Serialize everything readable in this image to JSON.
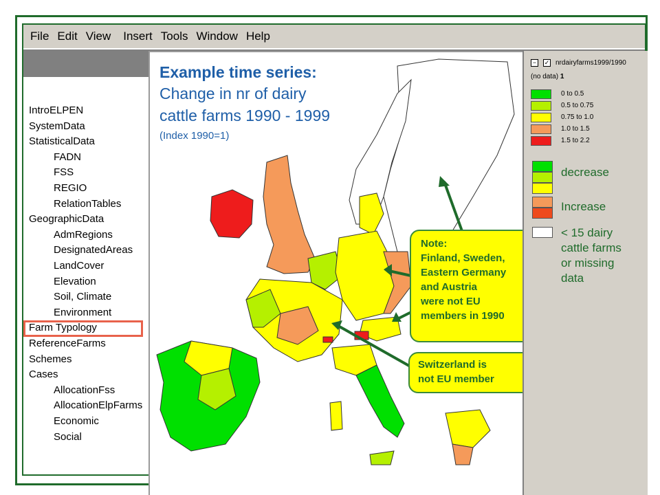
{
  "menu": [
    "File",
    "Edit",
    "View",
    "Insert",
    "Tools",
    "Window",
    "Help"
  ],
  "sidebar": {
    "items": [
      {
        "label": "IntroELPEN",
        "indent": 0
      },
      {
        "label": "SystemData",
        "indent": 0
      },
      {
        "label": "StatisticalData",
        "indent": 0
      },
      {
        "label": "FADN",
        "indent": 1
      },
      {
        "label": "FSS",
        "indent": 1
      },
      {
        "label": "REGIO",
        "indent": 1
      },
      {
        "label": "RelationTables",
        "indent": 1
      },
      {
        "label": "GeographicData",
        "indent": 0
      },
      {
        "label": "AdmRegions",
        "indent": 1
      },
      {
        "label": "DesignatedAreas",
        "indent": 1
      },
      {
        "label": "LandCover",
        "indent": 1
      },
      {
        "label": "Elevation",
        "indent": 1
      },
      {
        "label": "Soil, Climate",
        "indent": 1
      },
      {
        "label": "Environment",
        "indent": 1
      },
      {
        "label": "Farm Typology",
        "indent": 0,
        "selected": true
      },
      {
        "label": "ReferenceFarms",
        "indent": 0
      },
      {
        "label": "Schemes",
        "indent": 0
      },
      {
        "label": "Cases",
        "indent": 0
      },
      {
        "label": "AllocationFss",
        "indent": 1
      },
      {
        "label": "AllocationElpFarms",
        "indent": 1
      },
      {
        "label": "Economic",
        "indent": 1
      },
      {
        "label": "Social",
        "indent": 1
      }
    ]
  },
  "map": {
    "title": "Example time series:",
    "subtitle_line1": "Change in nr of dairy",
    "subtitle_line2": "cattle farms 1990 - 1999",
    "index_note": "(Index 1990=1)"
  },
  "notes": {
    "note1": [
      "Note:",
      "Finland, Sweden,",
      "Eastern Germany",
      "and Austria",
      "were not EU",
      "members in 1990"
    ],
    "note2": [
      "Switzerland is",
      "not EU member"
    ]
  },
  "legend": {
    "layer_name": "nrdairyfarms1999/1990",
    "no_data_label": "(no data)",
    "no_data_value": "1",
    "classes": [
      {
        "label": "0 to 0.5",
        "color": "#00e000"
      },
      {
        "label": "0.5 to 0.75",
        "color": "#b5f000"
      },
      {
        "label": "0.75 to 1.0",
        "color": "#ffff00"
      },
      {
        "label": "1.0 to 1.5",
        "color": "#f59a5a"
      },
      {
        "label": "1.5 to 2.2",
        "color": "#ee1c1c"
      }
    ],
    "decrease_label": "decrease",
    "increase_label": "Increase",
    "missing_line1": "< 15 dairy",
    "missing_line2": "cattle farms",
    "missing_line3": "or missing",
    "missing_line4": "data"
  },
  "colors": {
    "frame": "#1f6b2b",
    "title": "#1f5fa8",
    "note_bg": "#ffff00",
    "highlight": "#e8624b"
  }
}
